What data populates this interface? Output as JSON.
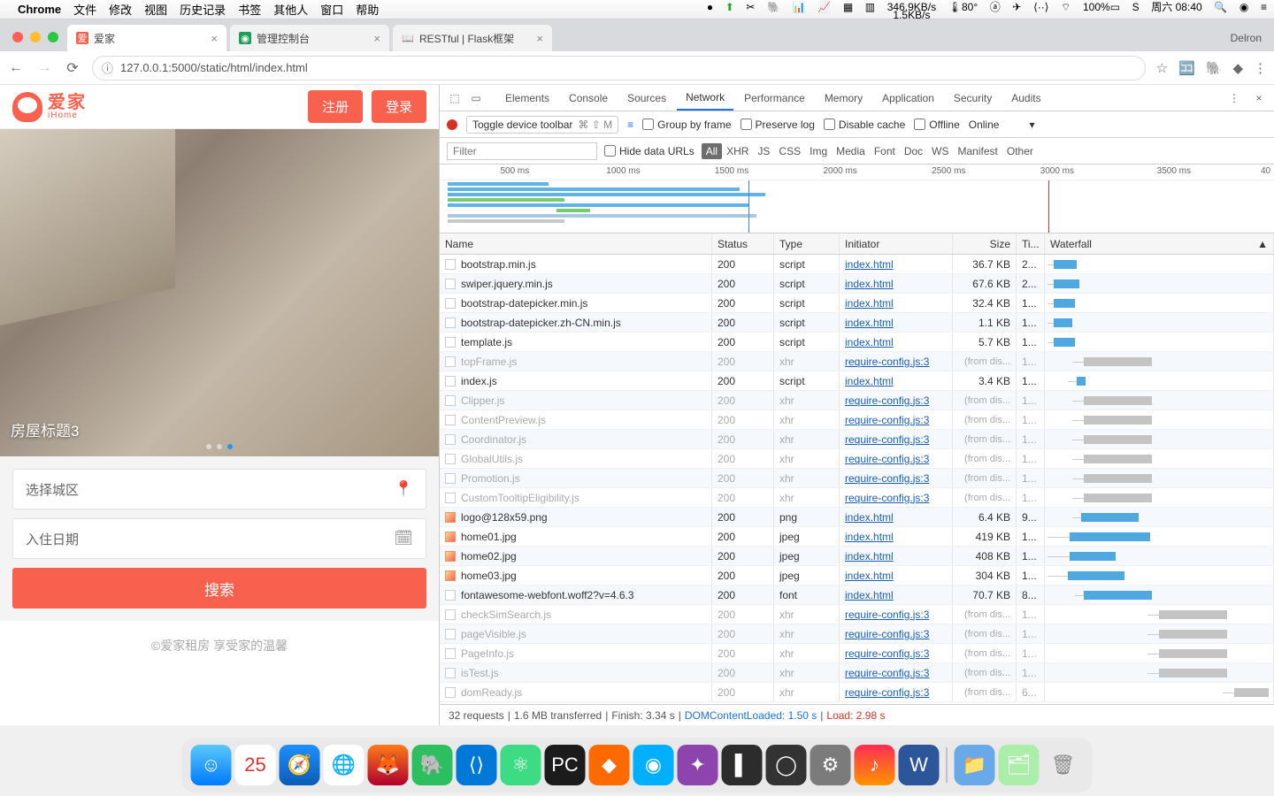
{
  "menubar": {
    "app": "Chrome",
    "items": [
      "文件",
      "修改",
      "视图",
      "历史记录",
      "书签",
      "其他人",
      "窗口",
      "帮助"
    ],
    "right": {
      "temp": "80°",
      "net_up": "346.9KB/s",
      "net_dn": "1.5KB/s",
      "battery": "100%",
      "clock": "周六 08:40",
      "user": "Delron"
    }
  },
  "tabs": [
    {
      "title": "爱家",
      "active": true
    },
    {
      "title": "管理控制台",
      "active": false
    },
    {
      "title": "RESTful | Flask框架",
      "active": false
    }
  ],
  "url": "127.0.0.1:5000/static/html/index.html",
  "app": {
    "logo_cn": "爱家",
    "logo_en": "iHome",
    "register": "注册",
    "login": "登录",
    "hero_caption": "房屋标题3",
    "city_placeholder": "选择城区",
    "date_placeholder": "入住日期",
    "search": "搜索",
    "footer": "©爱家租房  享受家的温馨"
  },
  "devtools": {
    "tabs": [
      "Elements",
      "Console",
      "Sources",
      "Network",
      "Performance",
      "Memory",
      "Application",
      "Security",
      "Audits"
    ],
    "active_tab": "Network",
    "toggle_device": "Toggle device toolbar",
    "shortcut": "⌘ ⇧ M",
    "group_by_frame": "Group by frame",
    "preserve_log": "Preserve log",
    "disable_cache": "Disable cache",
    "offline": "Offline",
    "online": "Online",
    "filter_placeholder": "Filter",
    "hide_urls": "Hide data URLs",
    "filter_types": [
      "All",
      "XHR",
      "JS",
      "CSS",
      "Img",
      "Media",
      "Font",
      "Doc",
      "WS",
      "Manifest",
      "Other"
    ],
    "timeline_ticks": [
      "500 ms",
      "1000 ms",
      "1500 ms",
      "2000 ms",
      "2500 ms",
      "3000 ms",
      "3500 ms",
      "40"
    ],
    "columns": [
      "Name",
      "Status",
      "Type",
      "Initiator",
      "Size",
      "Ti...",
      "Waterfall"
    ],
    "rows": [
      {
        "name": "bootstrap.min.js",
        "status": "200",
        "type": "script",
        "init": "index.html",
        "size": "36.7 KB",
        "time": "2...",
        "wf": [
          1,
          3,
          10,
          "b"
        ],
        "dim": false
      },
      {
        "name": "swiper.jquery.min.js",
        "status": "200",
        "type": "script",
        "init": "index.html",
        "size": "67.6 KB",
        "time": "2...",
        "wf": [
          1,
          3,
          11,
          "b"
        ],
        "dim": false
      },
      {
        "name": "bootstrap-datepicker.min.js",
        "status": "200",
        "type": "script",
        "init": "index.html",
        "size": "32.4 KB",
        "time": "1...",
        "wf": [
          1,
          3,
          9,
          "b"
        ],
        "dim": false
      },
      {
        "name": "bootstrap-datepicker.zh-CN.min.js",
        "status": "200",
        "type": "script",
        "init": "index.html",
        "size": "1.1 KB",
        "time": "1...",
        "wf": [
          1,
          3,
          8,
          "b"
        ],
        "dim": false
      },
      {
        "name": "template.js",
        "status": "200",
        "type": "script",
        "init": "index.html",
        "size": "5.7 KB",
        "time": "1...",
        "wf": [
          1,
          3,
          9,
          "b"
        ],
        "dim": false
      },
      {
        "name": "topFrame.js",
        "status": "200",
        "type": "xhr",
        "init": "require-config.js:3",
        "size": "(from dis...",
        "time": "1...",
        "wf": [
          12,
          5,
          30,
          "grey"
        ],
        "dim": true
      },
      {
        "name": "index.js",
        "status": "200",
        "type": "script",
        "init": "index.html",
        "size": "3.4 KB",
        "time": "1...",
        "wf": [
          10,
          4,
          4,
          "b"
        ],
        "dim": false
      },
      {
        "name": "Clipper.js",
        "status": "200",
        "type": "xhr",
        "init": "require-config.js:3",
        "size": "(from dis...",
        "time": "1...",
        "wf": [
          12,
          5,
          30,
          "grey"
        ],
        "dim": true
      },
      {
        "name": "ContentPreview.js",
        "status": "200",
        "type": "xhr",
        "init": "require-config.js:3",
        "size": "(from dis...",
        "time": "1...",
        "wf": [
          12,
          5,
          30,
          "grey"
        ],
        "dim": true
      },
      {
        "name": "Coordinator.js",
        "status": "200",
        "type": "xhr",
        "init": "require-config.js:3",
        "size": "(from dis...",
        "time": "1...",
        "wf": [
          12,
          5,
          30,
          "grey"
        ],
        "dim": true
      },
      {
        "name": "GlobalUtils.js",
        "status": "200",
        "type": "xhr",
        "init": "require-config.js:3",
        "size": "(from dis...",
        "time": "1...",
        "wf": [
          12,
          5,
          30,
          "grey"
        ],
        "dim": true
      },
      {
        "name": "Promotion.js",
        "status": "200",
        "type": "xhr",
        "init": "require-config.js:3",
        "size": "(from dis...",
        "time": "1...",
        "wf": [
          12,
          5,
          30,
          "grey"
        ],
        "dim": true
      },
      {
        "name": "CustomTooltipEligibility.js",
        "status": "200",
        "type": "xhr",
        "init": "require-config.js:3",
        "size": "(from dis...",
        "time": "1...",
        "wf": [
          12,
          5,
          30,
          "grey"
        ],
        "dim": true
      },
      {
        "name": "logo@128x59.png",
        "status": "200",
        "type": "png",
        "init": "index.html",
        "size": "6.4 KB",
        "time": "9...",
        "wf": [
          12,
          4,
          25,
          "b"
        ],
        "dim": false,
        "img": true
      },
      {
        "name": "home01.jpg",
        "status": "200",
        "type": "jpeg",
        "init": "index.html",
        "size": "419 KB",
        "time": "1...",
        "wf": [
          1,
          10,
          35,
          "b"
        ],
        "dim": false,
        "img": true
      },
      {
        "name": "home02.jpg",
        "status": "200",
        "type": "jpeg",
        "init": "index.html",
        "size": "408 KB",
        "time": "1...",
        "wf": [
          1,
          10,
          20,
          "b"
        ],
        "dim": false,
        "img": true
      },
      {
        "name": "home03.jpg",
        "status": "200",
        "type": "jpeg",
        "init": "index.html",
        "size": "304 KB",
        "time": "1...",
        "wf": [
          1,
          9,
          25,
          "b"
        ],
        "dim": false,
        "img": true
      },
      {
        "name": "fontawesome-webfont.woff2?v=4.6.3",
        "status": "200",
        "type": "font",
        "init": "index.html",
        "size": "70.7 KB",
        "time": "8...",
        "wf": [
          13,
          4,
          30,
          "b"
        ],
        "dim": false
      },
      {
        "name": "checkSimSearch.js",
        "status": "200",
        "type": "xhr",
        "init": "require-config.js:3",
        "size": "(from dis...",
        "time": "1...",
        "wf": [
          45,
          5,
          30,
          "grey"
        ],
        "dim": true
      },
      {
        "name": "pageVisible.js",
        "status": "200",
        "type": "xhr",
        "init": "require-config.js:3",
        "size": "(from dis...",
        "time": "1...",
        "wf": [
          45,
          5,
          30,
          "grey"
        ],
        "dim": true
      },
      {
        "name": "PageInfo.js",
        "status": "200",
        "type": "xhr",
        "init": "require-config.js:3",
        "size": "(from dis...",
        "time": "1...",
        "wf": [
          45,
          5,
          30,
          "grey"
        ],
        "dim": true
      },
      {
        "name": "isTest.js",
        "status": "200",
        "type": "xhr",
        "init": "require-config.js:3",
        "size": "(from dis...",
        "time": "1...",
        "wf": [
          45,
          5,
          30,
          "grey"
        ],
        "dim": true
      },
      {
        "name": "domReady.js",
        "status": "200",
        "type": "xhr",
        "init": "require-config.js:3",
        "size": "(from dis...",
        "time": "6...",
        "wf": [
          78,
          5,
          15,
          "grey"
        ],
        "dim": true
      }
    ],
    "status": {
      "requests": "32 requests",
      "transferred": "1.6 MB transferred",
      "finish": "Finish: 3.34 s",
      "dcl": "DOMContentLoaded: 1.50 s",
      "load": "Load: 2.98 s"
    }
  }
}
